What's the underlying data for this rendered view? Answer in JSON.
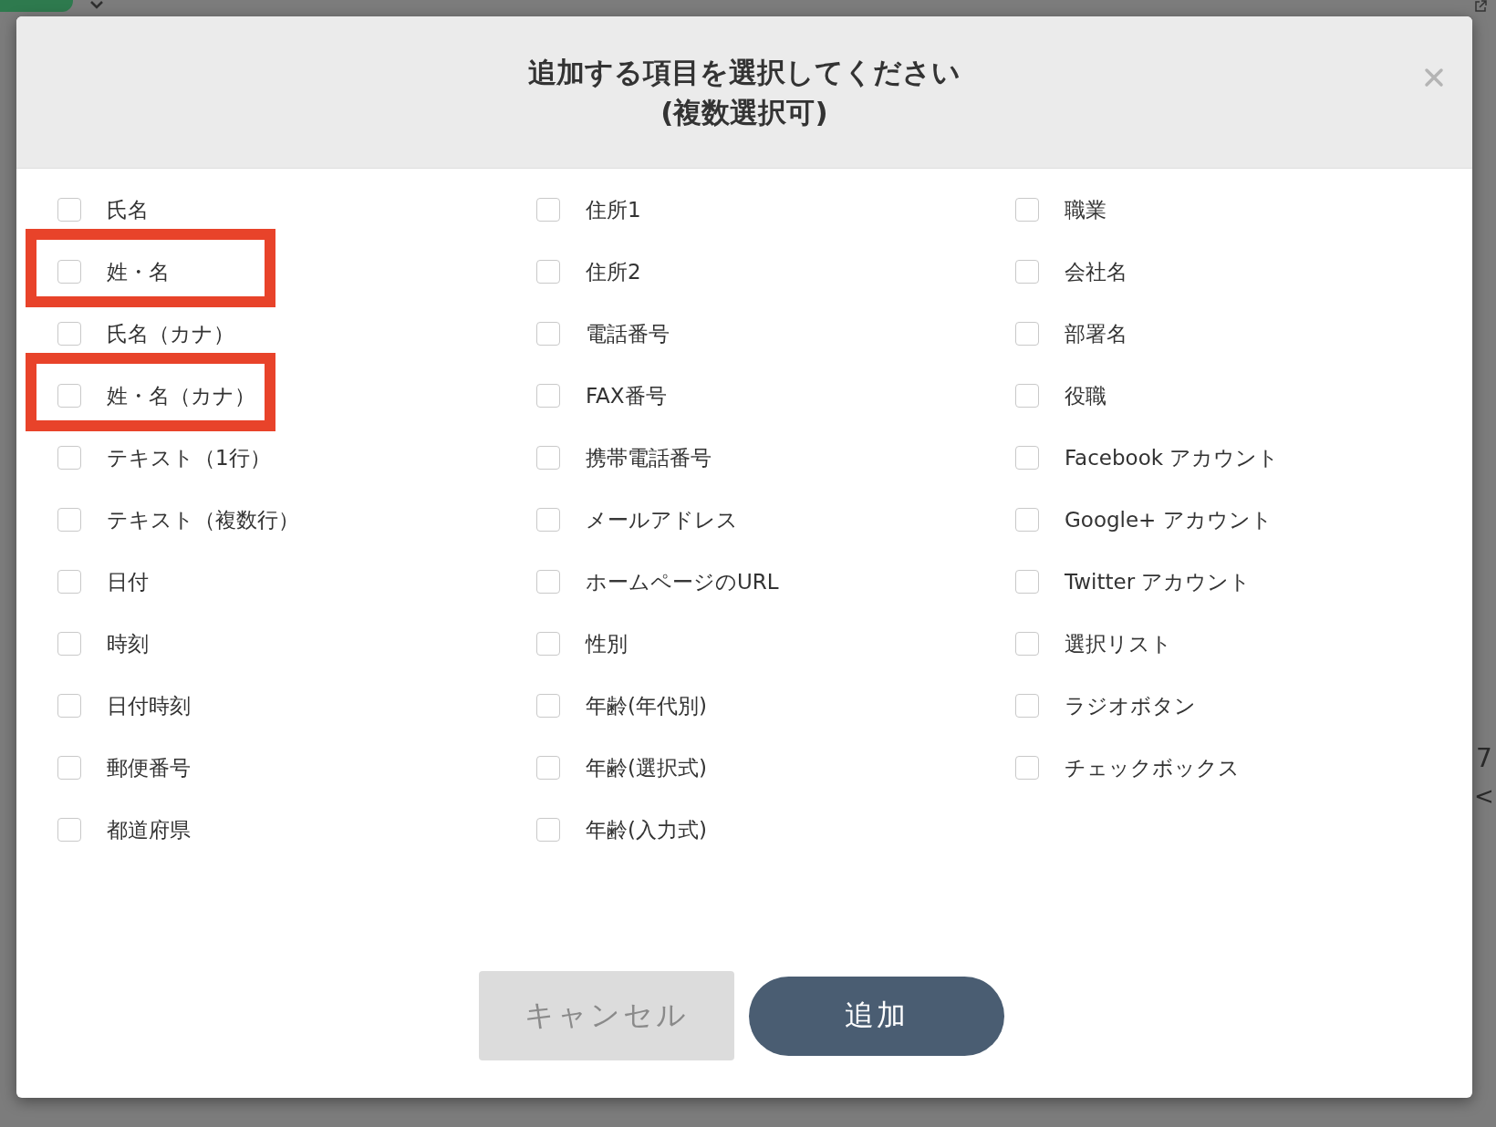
{
  "background": {
    "right_fragments": [
      "7",
      "<"
    ]
  },
  "dialog": {
    "title_lines": [
      "追加する項目を選択してください",
      "(複数選択可)"
    ],
    "columns": [
      {
        "items": [
          {
            "label": "氏名",
            "checked": false,
            "highlighted": false
          },
          {
            "label": "姓・名",
            "checked": false,
            "highlighted": true
          },
          {
            "label": "氏名（カナ）",
            "checked": false,
            "highlighted": false
          },
          {
            "label": "姓・名（カナ）",
            "checked": false,
            "highlighted": true
          },
          {
            "label": "テキスト（1行）",
            "checked": false,
            "highlighted": false
          },
          {
            "label": "テキスト（複数行）",
            "checked": false,
            "highlighted": false
          },
          {
            "label": "日付",
            "checked": false,
            "highlighted": false
          },
          {
            "label": "時刻",
            "checked": false,
            "highlighted": false
          },
          {
            "label": "日付時刻",
            "checked": false,
            "highlighted": false
          },
          {
            "label": "郵便番号",
            "checked": false,
            "highlighted": false
          },
          {
            "label": "都道府県",
            "checked": false,
            "highlighted": false
          }
        ]
      },
      {
        "items": [
          {
            "label": "住所1",
            "checked": false,
            "highlighted": false
          },
          {
            "label": "住所2",
            "checked": false,
            "highlighted": false
          },
          {
            "label": "電話番号",
            "checked": false,
            "highlighted": false
          },
          {
            "label": "FAX番号",
            "checked": false,
            "highlighted": false
          },
          {
            "label": "携帯電話番号",
            "checked": false,
            "highlighted": false
          },
          {
            "label": "メールアドレス",
            "checked": false,
            "highlighted": false
          },
          {
            "label": "ホームページのURL",
            "checked": false,
            "highlighted": false
          },
          {
            "label": "性別",
            "checked": false,
            "highlighted": false
          },
          {
            "label": "年齢(年代別)",
            "checked": false,
            "highlighted": false
          },
          {
            "label": "年齢(選択式)",
            "checked": false,
            "highlighted": false
          },
          {
            "label": "年齢(入力式)",
            "checked": false,
            "highlighted": false
          }
        ]
      },
      {
        "items": [
          {
            "label": "職業",
            "checked": false,
            "highlighted": false
          },
          {
            "label": "会社名",
            "checked": false,
            "highlighted": false
          },
          {
            "label": "部署名",
            "checked": false,
            "highlighted": false
          },
          {
            "label": "役職",
            "checked": false,
            "highlighted": false
          },
          {
            "label": "Facebook アカウント",
            "checked": false,
            "highlighted": false
          },
          {
            "label": "Google+ アカウント",
            "checked": false,
            "highlighted": false
          },
          {
            "label": "Twitter アカウント",
            "checked": false,
            "highlighted": false
          },
          {
            "label": "選択リスト",
            "checked": false,
            "highlighted": false
          },
          {
            "label": "ラジオボタン",
            "checked": false,
            "highlighted": false
          },
          {
            "label": "チェックボックス",
            "checked": false,
            "highlighted": false
          }
        ]
      }
    ],
    "buttons": [
      {
        "label": "キャンセル",
        "kind": "secondary"
      },
      {
        "label": "追加",
        "kind": "primary"
      }
    ]
  }
}
